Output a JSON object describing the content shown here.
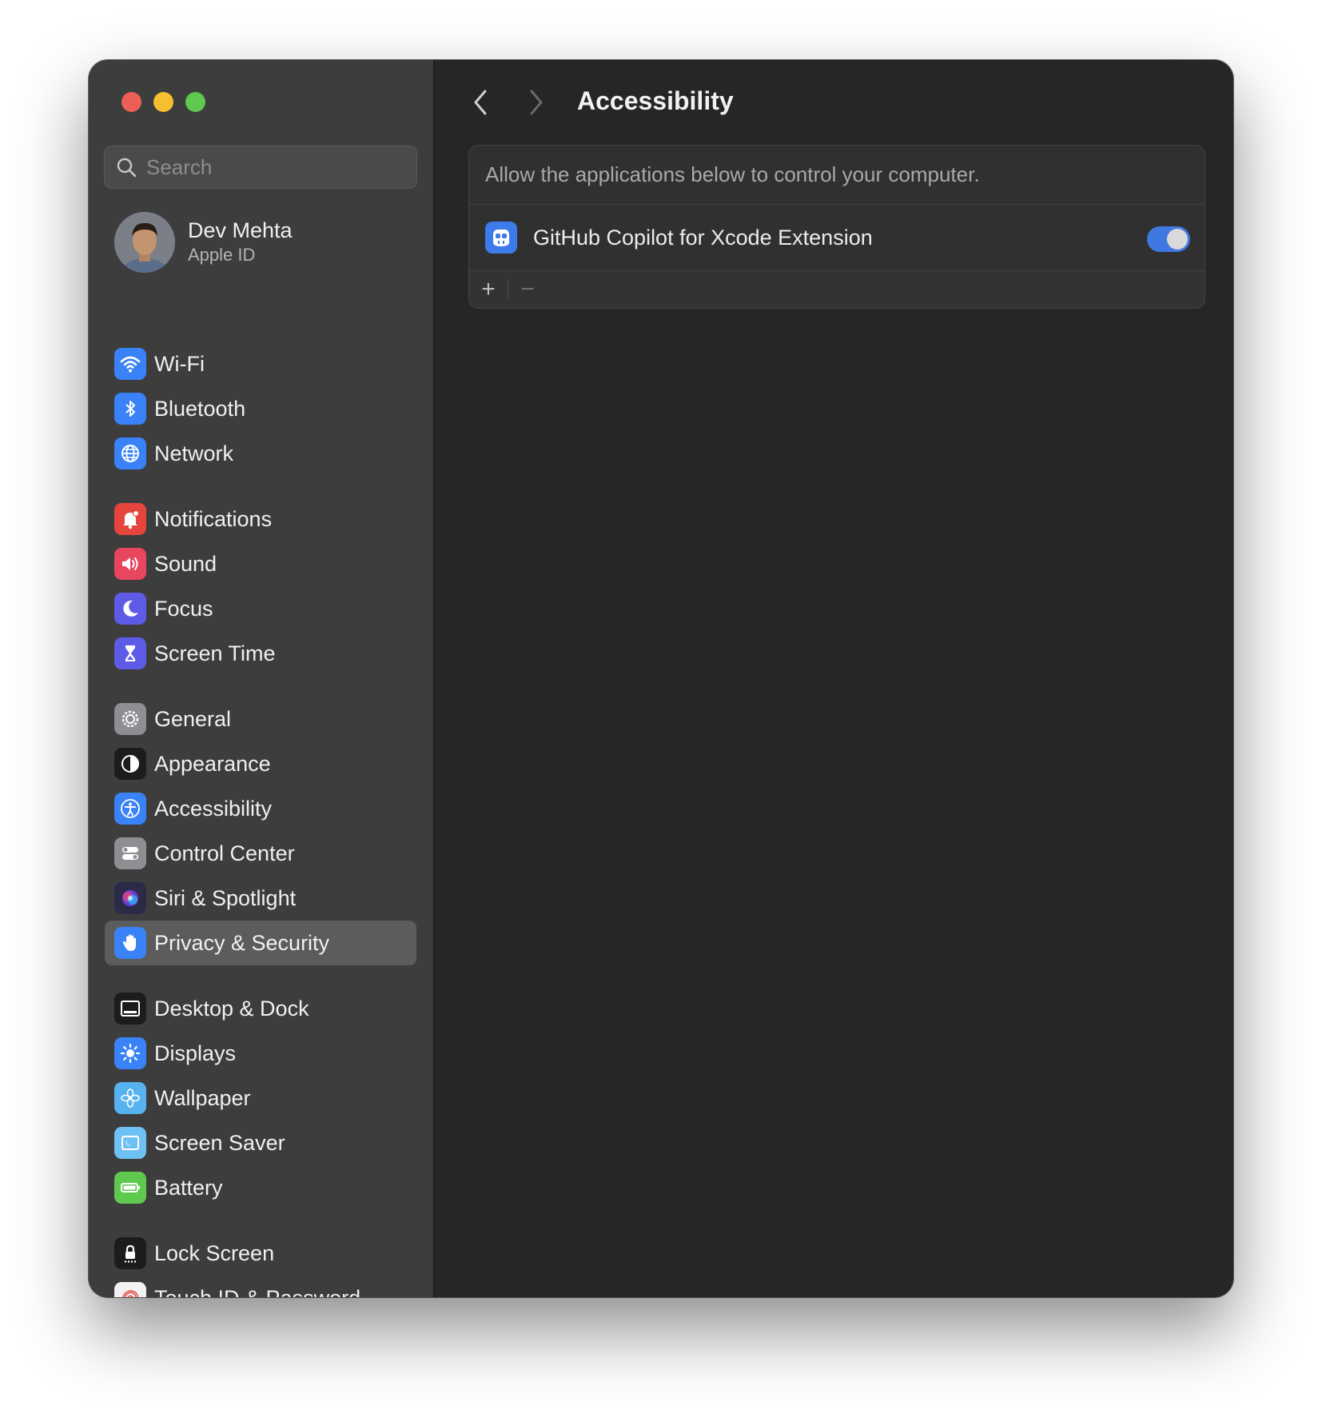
{
  "window": {
    "traffic_lights": {
      "close": "#ec5f57",
      "minimize": "#f5bf2f",
      "maximize": "#5fc84e"
    }
  },
  "search": {
    "placeholder": "Search",
    "value": ""
  },
  "profile": {
    "name": "Dev Mehta",
    "subtitle": "Apple ID"
  },
  "sidebar": {
    "selected": "Privacy & Security",
    "items": [
      {
        "label": "Wi-Fi",
        "icon": "wifi-icon",
        "color": "#3a82f7"
      },
      {
        "label": "Bluetooth",
        "icon": "bluetooth-icon",
        "color": "#3a82f7"
      },
      {
        "label": "Network",
        "icon": "globe-icon",
        "color": "#3a82f7"
      },
      {
        "label": "Notifications",
        "icon": "bell-icon",
        "color": "#e5453d"
      },
      {
        "label": "Sound",
        "icon": "speaker-icon",
        "color": "#e8455f"
      },
      {
        "label": "Focus",
        "icon": "moon-icon",
        "color": "#5e5ce6"
      },
      {
        "label": "Screen Time",
        "icon": "hourglass-icon",
        "color": "#5e5ce6"
      },
      {
        "label": "General",
        "icon": "gear-icon",
        "color": "#8e8e93"
      },
      {
        "label": "Appearance",
        "icon": "appearance-icon",
        "color": "#1c1c1e"
      },
      {
        "label": "Accessibility",
        "icon": "accessibility-icon",
        "color": "#3a82f7"
      },
      {
        "label": "Control Center",
        "icon": "toggles-icon",
        "color": "#8e8e93"
      },
      {
        "label": "Siri & Spotlight",
        "icon": "siri-icon",
        "color": "#2b2b48"
      },
      {
        "label": "Privacy & Security",
        "icon": "hand-icon",
        "color": "#3a82f7"
      },
      {
        "label": "Desktop & Dock",
        "icon": "dock-icon",
        "color": "#1c1c1e"
      },
      {
        "label": "Displays",
        "icon": "sun-icon",
        "color": "#3a82f7"
      },
      {
        "label": "Wallpaper",
        "icon": "flower-icon",
        "color": "#56b3f0"
      },
      {
        "label": "Screen Saver",
        "icon": "screen-saver-icon",
        "color": "#6ec1f3"
      },
      {
        "label": "Battery",
        "icon": "battery-icon",
        "color": "#5fc84e"
      },
      {
        "label": "Lock Screen",
        "icon": "lock-icon",
        "color": "#1c1c1e"
      },
      {
        "label": "Touch ID & Password",
        "icon": "fingerprint-icon",
        "color": "#f2f2f2"
      }
    ]
  },
  "toolbar": {
    "title": "Accessibility"
  },
  "panel": {
    "description": "Allow the applications below to control your computer.",
    "apps": [
      {
        "name": "GitHub Copilot for Xcode Extension",
        "icon": "copilot-icon",
        "enabled": true
      }
    ],
    "add_label": "+",
    "remove_label": "−"
  },
  "colors": {
    "accent": "#3e78e0",
    "sidebar_bg": "#3d3d3d",
    "main_bg": "#262626"
  }
}
